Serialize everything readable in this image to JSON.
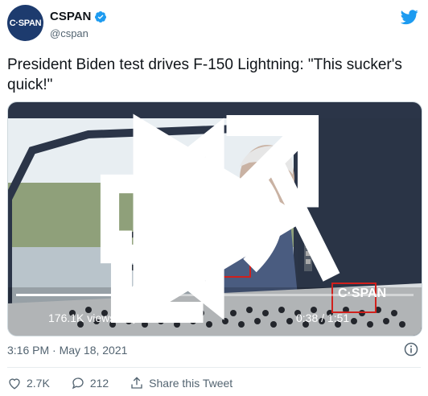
{
  "account": {
    "avatar_text": "C·SPAN",
    "name": "CSPAN",
    "handle": "@cspan"
  },
  "tweet": {
    "text": "President Biden test drives F-150 Lightning: \"This sucker's quick!\""
  },
  "video": {
    "views": "176.1K views",
    "time": "0:38 / 1:51",
    "watermark": "C·SPAN",
    "progress": 0.342
  },
  "meta": {
    "timestamp": "3:16 PM · May 18, 2021"
  },
  "actions": {
    "likes": "2.7K",
    "replies": "212",
    "share_label": "Share this Tweet"
  },
  "colors": {
    "twitter_blue": "#1d9bf0",
    "annotation_red": "#d0201c"
  }
}
